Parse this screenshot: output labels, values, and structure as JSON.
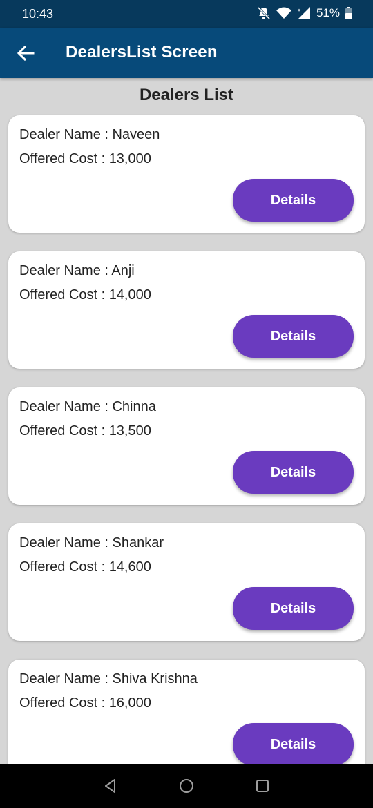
{
  "status_bar": {
    "time": "10:43",
    "battery": "51%",
    "icons": [
      "bell-off-icon",
      "wifi-icon",
      "signal-icon",
      "battery-icon"
    ]
  },
  "app_bar": {
    "title": "DealersList Screen",
    "back_icon": "arrow-left-icon"
  },
  "page": {
    "heading": "Dealers List"
  },
  "dealers": [
    {
      "name_line": "Dealer Name : Naveen",
      "cost_line": "Offered Cost : 13,000",
      "button_label": "Details"
    },
    {
      "name_line": "Dealer Name : Anji",
      "cost_line": "Offered Cost : 14,000",
      "button_label": "Details"
    },
    {
      "name_line": "Dealer Name : Chinna",
      "cost_line": "Offered Cost : 13,500",
      "button_label": "Details"
    },
    {
      "name_line": "Dealer Name : Shankar",
      "cost_line": "Offered Cost : 14,600",
      "button_label": "Details"
    },
    {
      "name_line": "Dealer Name : Shiva Krishna",
      "cost_line": "Offered Cost : 16,000",
      "button_label": "Details"
    }
  ],
  "nav_bar": {
    "icons": [
      "back-triangle-icon",
      "home-circle-icon",
      "recents-square-icon"
    ]
  },
  "colors": {
    "status_bar": "#07395c",
    "app_bar": "#074a7a",
    "background": "#d6d6d6",
    "button": "#6a3bbf"
  }
}
